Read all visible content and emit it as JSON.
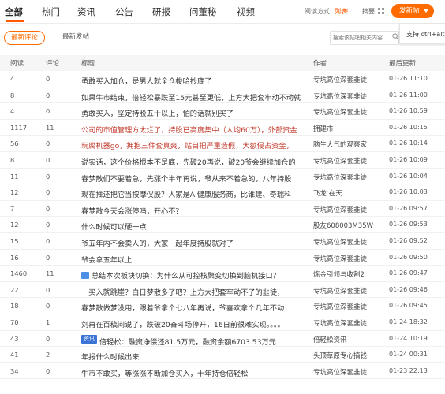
{
  "nav": {
    "tabs": [
      "全部",
      "热门",
      "资讯",
      "公告",
      "研报",
      "问董秘",
      "视频"
    ],
    "read_mode_label": "阅读方式:",
    "mode_list": "列表",
    "mode_summary": "摘要",
    "post_button": "发新帖",
    "accent_color": "#ff6b00"
  },
  "subbar": {
    "pill_latest_reply": "最新评论",
    "pill_latest_post": "最新发帖",
    "search_placeholder": "搜索该帖吧相关内容",
    "tooltip": "支持 ctrl+alt+"
  },
  "table": {
    "headers": {
      "read": "阅读",
      "comment": "评论",
      "title": "标题",
      "author": "作者",
      "time": "最后更新"
    },
    "rows": [
      {
        "read": "4",
        "comment": "0",
        "title": "勇敢买入加仓，是男人就全仓梭哈抄底了",
        "author": "专坑高位深套韭徒",
        "time": "01-26 11:10"
      },
      {
        "read": "8",
        "comment": "0",
        "title": "如果牛市结束，倍轻松暴跌至15元甚至更低，上方大把套牢动不动就",
        "author": "专坑高位深套韭徒",
        "time": "01-26 11:00"
      },
      {
        "read": "4",
        "comment": "0",
        "title": "勇敢买入，坚定持股五十以上，怕的话就别买了",
        "author": "专坑高位深套韭徒",
        "time": "01-26 10:59"
      },
      {
        "read": "1117",
        "comment": "11",
        "title": "公司的市值管理方太烂了，持股已高度集中（人均60万），外部资金",
        "author": "拥建市",
        "time": "01-26 10:15",
        "hl": true
      },
      {
        "read": "56",
        "comment": "0",
        "title": "玩腐机器go，拥抱三件套真爽，站目把严重造假，大额侵占资金，",
        "author": "脑生大气的观察家",
        "time": "01-26 10:14",
        "hl": true
      },
      {
        "read": "8",
        "comment": "0",
        "title": "说实话，这个价格根本不是底，先破20再说，破20爷会继续加仓的",
        "author": "专坑高位深套韭徒",
        "time": "01-26 10:09"
      },
      {
        "read": "11",
        "comment": "0",
        "title": "春梦散们不要着急，先涨个半年再说，爷从来不着急的，八年持股",
        "author": "专坑高位深套韭徒",
        "time": "01-26 10:04"
      },
      {
        "read": "12",
        "comment": "0",
        "title": "现在推还把它当按摩仪股？人家是AI健康服务商，比谁建、奇瑞科",
        "author": "飞龙 在天",
        "time": "01-26 10:03"
      },
      {
        "read": "7",
        "comment": "0",
        "title": "春梦散今天会涨停吗，开心不？",
        "author": "专坑高位深套韭徒",
        "time": "01-26 09:57"
      },
      {
        "read": "12",
        "comment": "0",
        "title": "什么时候可以硬一点",
        "author": "股友608003M35W",
        "time": "01-26 09:53"
      },
      {
        "read": "15",
        "comment": "0",
        "title": "爷五年内不会卖人的，大家一起年度持股就对了",
        "author": "专坑高位深套韭徒",
        "time": "01-26 09:52"
      },
      {
        "read": "16",
        "comment": "0",
        "title": "爷会拿五年以上",
        "author": "专坑高位深套韭徒",
        "time": "01-26 09:50"
      },
      {
        "read": "1460",
        "comment": "11",
        "title": "总结本次板块切换：为什么从可控核聚变切换到脑机接口？",
        "author": "炼金引领与收割2",
        "time": "01-26 09:47",
        "icon": true
      },
      {
        "read": "22",
        "comment": "0",
        "title": "一买入就跳崖？白日梦散多了吧？上方大把套牢动不了的韭徒，",
        "author": "专坑高位深套韭徒",
        "time": "01-26 09:46"
      },
      {
        "read": "18",
        "comment": "0",
        "title": "春梦散做梦没用，跟着爷拿个七八年再说，爷喜欢拿个几年不动",
        "author": "专坑高位深套韭徒",
        "time": "01-26 09:45"
      },
      {
        "read": "70",
        "comment": "1",
        "title": "刘再在百稿间说了，跌破20奋斗场停开，16日前很难实现。。。。",
        "author": "专坑高位深套韭徒",
        "time": "01-24 18:32"
      },
      {
        "read": "43",
        "comment": "0",
        "title": "倍轻松：融资净偿还81.5万元，融资余额6703.53万元",
        "author": "倍轻松资讯",
        "time": "01-24 10:19",
        "tag": "资讯"
      },
      {
        "read": "41",
        "comment": "2",
        "title": "年报什么时候出来",
        "author": "头顶草原专心搞钱",
        "time": "01-24 00:31"
      },
      {
        "read": "34",
        "comment": "0",
        "title": "牛市不敢买，等涨涨不断加仓买入，十年持仓倍轻松",
        "author": "专坑高位深套韭徒",
        "time": "01-23 22:13"
      }
    ]
  }
}
